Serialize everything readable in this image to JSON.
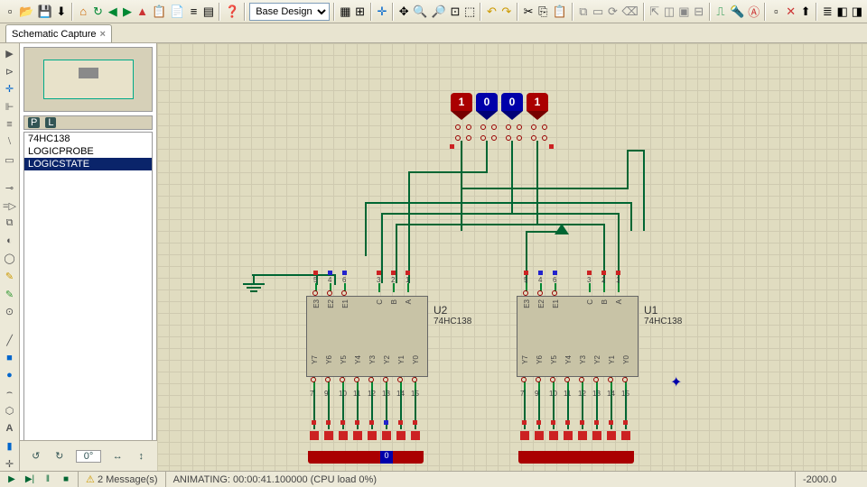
{
  "toolbar": {
    "design_mode": "Base Design"
  },
  "tab": {
    "label": "Schematic Capture"
  },
  "devices": {
    "header_p": "P",
    "header_l": "L",
    "items": [
      "74HC138",
      "LOGICPROBE",
      "LOGICSTATE"
    ],
    "selected": 2
  },
  "rotation": "0°",
  "chips": [
    {
      "ref": "U2",
      "part": "74HC138"
    },
    {
      "ref": "U1",
      "part": "74HC138"
    }
  ],
  "logic_inputs": [
    {
      "state": "1"
    },
    {
      "state": "0"
    },
    {
      "state": "0"
    },
    {
      "state": "1"
    }
  ],
  "pins_top": [
    "E3",
    "E2",
    "E1",
    "",
    "C",
    "B",
    "A"
  ],
  "pins_top_n": [
    "5",
    "4",
    "6",
    "",
    "3",
    "2",
    "1"
  ],
  "pins_bot": [
    "Y7",
    "Y6",
    "Y5",
    "Y4",
    "Y3",
    "Y2",
    "Y1",
    "Y0"
  ],
  "pins_bot_n": [
    "7",
    "9",
    "10",
    "11",
    "12",
    "13",
    "14",
    "15"
  ],
  "status": {
    "messages": "2 Message(s)",
    "anim": "ANIMATING: 00:00:41.100000 (CPU load 0%)",
    "coord": "-2000.0"
  }
}
